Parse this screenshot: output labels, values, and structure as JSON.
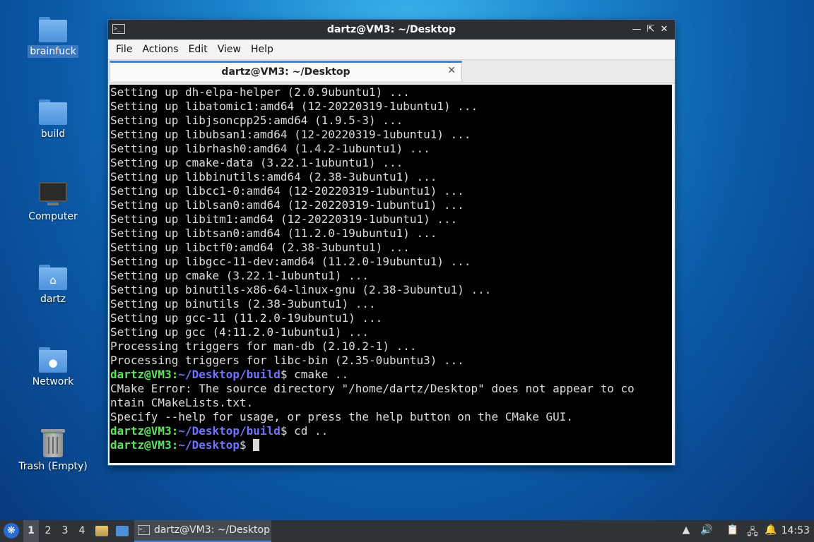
{
  "desktop": {
    "icons": [
      {
        "label": "brainfuck"
      },
      {
        "label": "build"
      },
      {
        "label": "Computer"
      },
      {
        "label": "dartz"
      },
      {
        "label": "Network"
      },
      {
        "label": "Trash (Empty)"
      }
    ]
  },
  "window": {
    "title": "dartz@VM3: ~/Desktop",
    "menu": [
      "File",
      "Actions",
      "Edit",
      "View",
      "Help"
    ],
    "tab": {
      "label": "dartz@VM3: ~/Desktop"
    }
  },
  "terminal": {
    "lines": [
      "Setting up dh-elpa-helper (2.0.9ubuntu1) ...",
      "Setting up libatomic1:amd64 (12-20220319-1ubuntu1) ...",
      "Setting up libjsoncpp25:amd64 (1.9.5-3) ...",
      "Setting up libubsan1:amd64 (12-20220319-1ubuntu1) ...",
      "Setting up librhash0:amd64 (1.4.2-1ubuntu1) ...",
      "Setting up cmake-data (3.22.1-1ubuntu1) ...",
      "Setting up libbinutils:amd64 (2.38-3ubuntu1) ...",
      "Setting up libcc1-0:amd64 (12-20220319-1ubuntu1) ...",
      "Setting up liblsan0:amd64 (12-20220319-1ubuntu1) ...",
      "Setting up libitm1:amd64 (12-20220319-1ubuntu1) ...",
      "Setting up libtsan0:amd64 (11.2.0-19ubuntu1) ...",
      "Setting up libctf0:amd64 (2.38-3ubuntu1) ...",
      "Setting up libgcc-11-dev:amd64 (11.2.0-19ubuntu1) ...",
      "Setting up cmake (3.22.1-1ubuntu1) ...",
      "Setting up binutils-x86-64-linux-gnu (2.38-3ubuntu1) ...",
      "Setting up binutils (2.38-3ubuntu1) ...",
      "Setting up gcc-11 (11.2.0-19ubuntu1) ...",
      "Setting up gcc (4:11.2.0-1ubuntu1) ...",
      "Processing triggers for man-db (2.10.2-1) ...",
      "Processing triggers for libc-bin (2.35-0ubuntu3) ..."
    ],
    "prompt1": {
      "user": "dartz@VM3",
      "sep": ":",
      "path": "~/Desktop/build",
      "sym": "$ ",
      "cmd": "cmake .."
    },
    "error_lines": [
      "CMake Error: The source directory \"/home/dartz/Desktop\" does not appear to co",
      "ntain CMakeLists.txt.",
      "Specify --help for usage, or press the help button on the CMake GUI."
    ],
    "prompt2": {
      "user": "dartz@VM3",
      "sep": ":",
      "path": "~/Desktop/build",
      "sym": "$ ",
      "cmd": "cd .."
    },
    "prompt3": {
      "user": "dartz@VM3",
      "sep": ":",
      "path": "~/Desktop",
      "sym": "$ "
    }
  },
  "taskbar": {
    "workspaces": [
      "1",
      "2",
      "3",
      "4"
    ],
    "task_label": "dartz@VM3: ~/Desktop",
    "clock": "14:53"
  },
  "colors": {
    "prompt_user": "#5fe35f",
    "prompt_path": "#6e74ff",
    "accent": "#3b83d6"
  }
}
